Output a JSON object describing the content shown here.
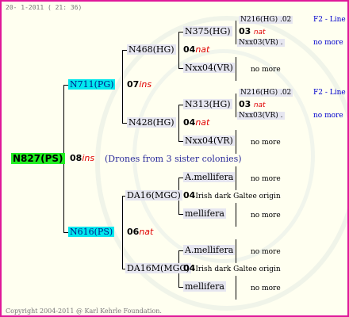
{
  "header_date": "20- 1-2011 ( 21: 36)",
  "footer": "Copyright 2004-2011 @ Karl Kehrle Foundation.",
  "root": {
    "id": "N827(PS)",
    "year": "08",
    "type": "ins",
    "note": "(Drones from 3 sister colonies)"
  },
  "f1": {
    "id": "N711(PG)",
    "year": "07",
    "type": "ins"
  },
  "m1": {
    "id": "N616(PS)",
    "year": "06",
    "type": "nat"
  },
  "g1": {
    "id": "N468(HG)",
    "year": "04",
    "type": "nat"
  },
  "g2": {
    "id": "N428(HG)",
    "year": "04",
    "type": "nat"
  },
  "g3": {
    "id": "DA16(MGC)",
    "year": "04",
    "text": "Irish dark Galtee origin"
  },
  "g4": {
    "id": "DA16M(MGC)",
    "year": "04",
    "text": "Irish dark Galtee origin"
  },
  "gg": [
    {
      "id": "N375(HG)",
      "mid": "03",
      "type": "nat",
      "right": {
        "top": "N216(HG) .02",
        "top2": "F2 - Line",
        "bot": "Nxx03(VR) .",
        "bot2": "no more"
      }
    },
    {
      "id": "Nxx04(VR)",
      "right": {
        "only": "no more"
      }
    },
    {
      "id": "N313(HG)",
      "mid": "03",
      "type": "nat",
      "right": {
        "top": "N216(HG) .02",
        "top2": "F2 - Line",
        "bot": "Nxx03(VR) .",
        "bot2": "no more"
      }
    },
    {
      "id": "Nxx04(VR)",
      "right": {
        "only": "no more"
      }
    },
    {
      "id": "A.mellifera",
      "right": {
        "only": "no more"
      }
    },
    {
      "id": "mellifera",
      "right": {
        "only": "no more"
      }
    },
    {
      "id": "A.mellifera",
      "right": {
        "only": "no more"
      }
    },
    {
      "id": "mellifera",
      "right": {
        "only": "no more"
      }
    }
  ]
}
